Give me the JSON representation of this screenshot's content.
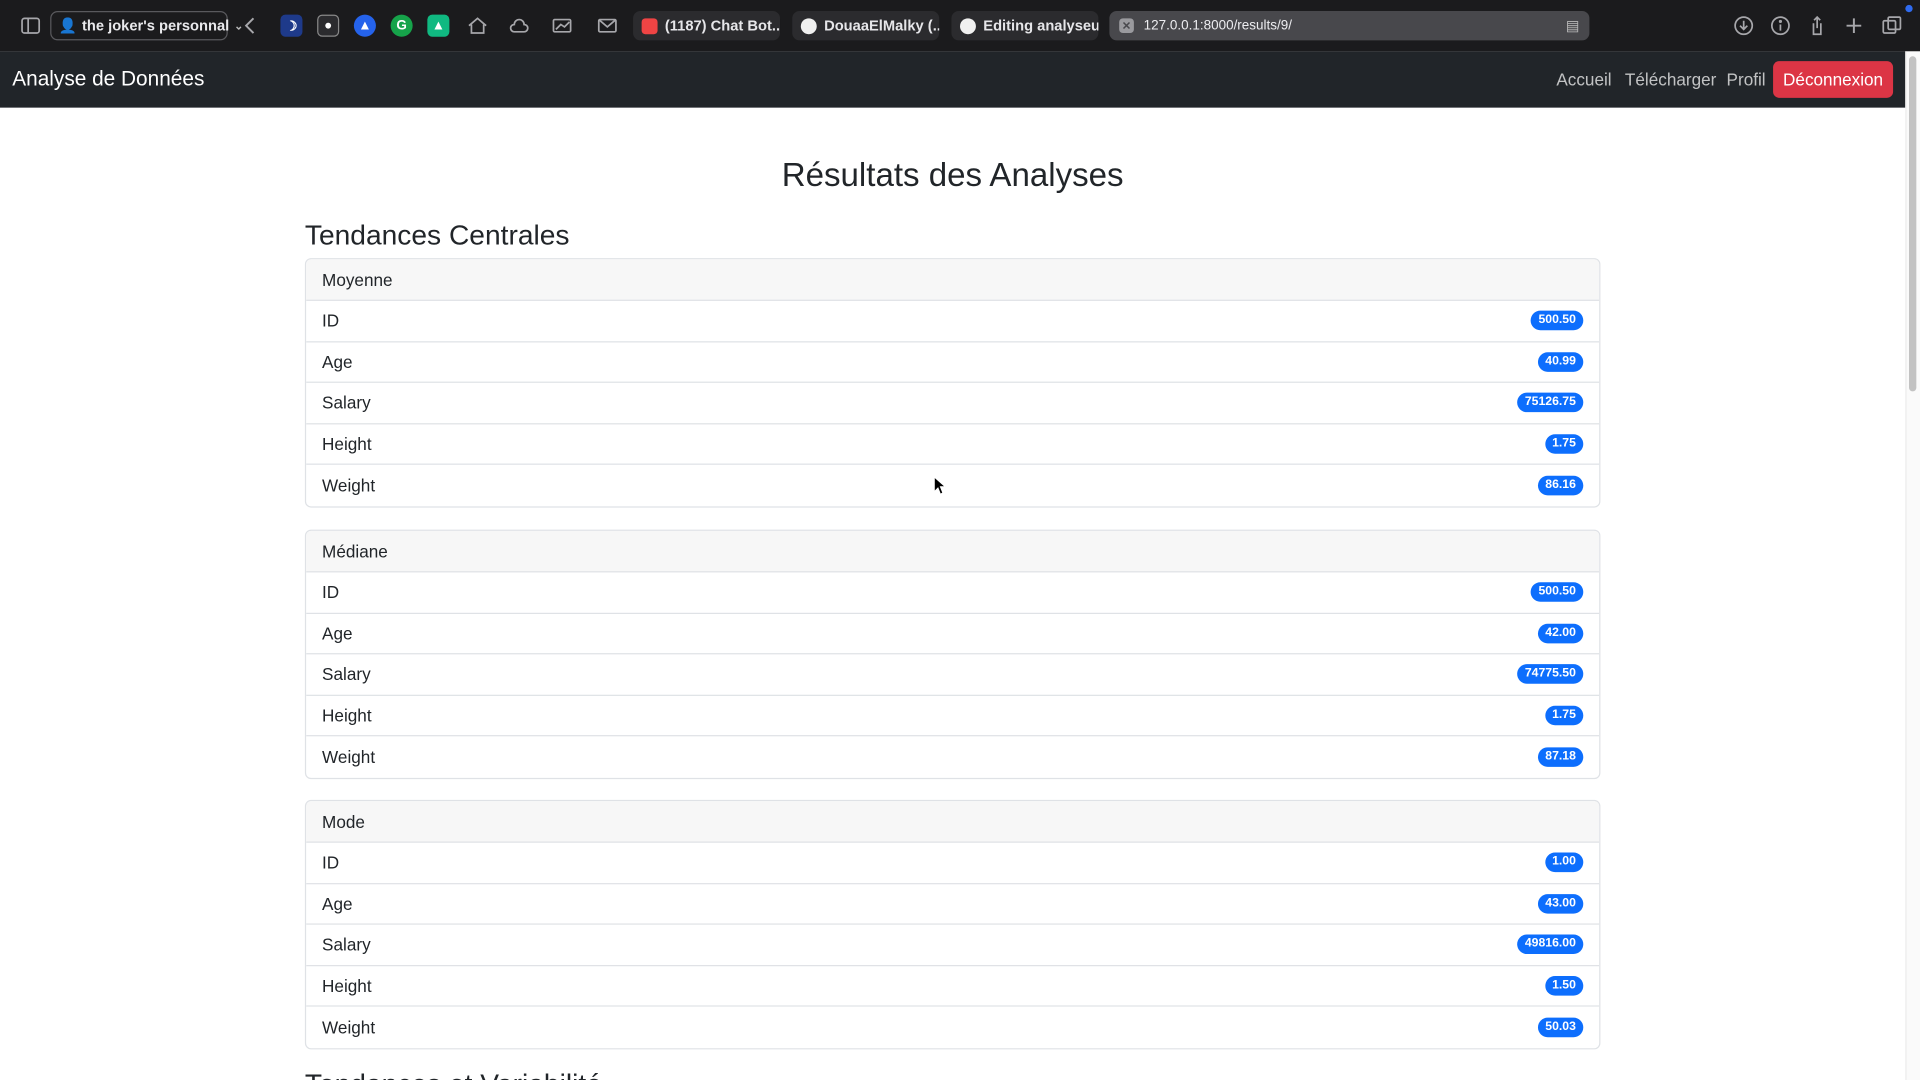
{
  "browser": {
    "profile": "the joker's personnal",
    "tabs": [
      {
        "title": "(1187) Chat Bot..."
      },
      {
        "title": "DouaaElMalky (..."
      },
      {
        "title": "Editing analyseu..."
      }
    ],
    "url": "127.0.0.1:8000/results/9/"
  },
  "navbar": {
    "brand": "Analyse de Données",
    "links": [
      "Accueil",
      "Télécharger",
      "Profil"
    ],
    "logout": "Déconnexion"
  },
  "page": {
    "title": "Résultats des Analyses",
    "section_title": "Tendances Centrales",
    "next_section_title": "Tendances et Variabilité"
  },
  "cards": [
    {
      "header": "Moyenne",
      "rows": [
        {
          "label": "ID",
          "value": "500.50"
        },
        {
          "label": "Age",
          "value": "40.99"
        },
        {
          "label": "Salary",
          "value": "75126.75"
        },
        {
          "label": "Height",
          "value": "1.75"
        },
        {
          "label": "Weight",
          "value": "86.16"
        }
      ]
    },
    {
      "header": "Médiane",
      "rows": [
        {
          "label": "ID",
          "value": "500.50"
        },
        {
          "label": "Age",
          "value": "42.00"
        },
        {
          "label": "Salary",
          "value": "74775.50"
        },
        {
          "label": "Height",
          "value": "1.75"
        },
        {
          "label": "Weight",
          "value": "87.18"
        }
      ]
    },
    {
      "header": "Mode",
      "rows": [
        {
          "label": "ID",
          "value": "1.00"
        },
        {
          "label": "Age",
          "value": "43.00"
        },
        {
          "label": "Salary",
          "value": "49816.00"
        },
        {
          "label": "Height",
          "value": "1.50"
        },
        {
          "label": "Weight",
          "value": "50.03"
        }
      ]
    }
  ],
  "colors": {
    "navbar_bg": "#212529",
    "logout_bg": "#dc3545",
    "badge_bg": "#0d6efd",
    "browser_bg": "#1b1b1d"
  }
}
